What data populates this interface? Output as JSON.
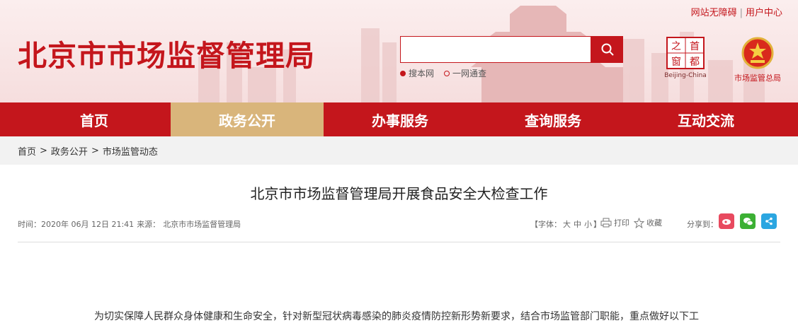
{
  "header": {
    "site_title": "北京市市场监督管理局",
    "toplinks": [
      "网站无障碍",
      "用户中心"
    ],
    "search": {
      "placeholder": "",
      "options": [
        "搜本网",
        "一网通查"
      ],
      "selected": "搜本网"
    },
    "capital_logo": {
      "chars": [
        "首",
        "都",
        "之",
        "窗"
      ],
      "caption": "Beijing-China"
    },
    "emblem_caption": "市场监管总局"
  },
  "nav": {
    "items": [
      "首页",
      "政务公开",
      "办事服务",
      "查询服务",
      "互动交流"
    ],
    "active": "政务公开"
  },
  "breadcrumb": [
    "首页",
    "政务公开",
    "市场监管动态"
  ],
  "article": {
    "title": "北京市市场监督管理局开展食品安全大检查工作",
    "time_label": "时间：",
    "time": "2020年 06月 12日 21:41",
    "source_label": "来源：",
    "source": "北京市市场监督管理局",
    "fontsize": {
      "prefix": "【字体：",
      "sizes": [
        "大",
        "中",
        "小"
      ],
      "suffix": "】"
    },
    "print_label": "打印",
    "favorite_label": "收藏",
    "share_label": "分享到：",
    "share_icons": [
      "weibo-icon",
      "wechat-icon",
      "share-icon"
    ],
    "body_first_line": "为切实保障人民群众身体健康和生命安全，针对新型冠状病毒感染的肺炎疫情防控新形势新要求，结合市场监管部门职能，重点做好以下工"
  },
  "colors": {
    "brand_red": "#c4161c",
    "nav_active": "#d9b57b",
    "breadcrumb_bg": "#f2f2f2"
  }
}
